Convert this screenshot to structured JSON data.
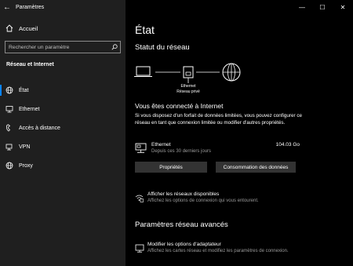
{
  "window": {
    "title": "Paramètres",
    "controls": [
      "—",
      "☐",
      "✕"
    ]
  },
  "sidebar": {
    "home_label": "Accueil",
    "search_placeholder": "Rechercher un paramètre",
    "section_title": "Réseau et Internet",
    "items": [
      {
        "label": "État",
        "icon": "globe-status-icon",
        "active": true
      },
      {
        "label": "Ethernet",
        "icon": "ethernet-icon",
        "active": false
      },
      {
        "label": "Accès à distance",
        "icon": "dialup-icon",
        "active": false
      },
      {
        "label": "VPN",
        "icon": "vpn-icon",
        "active": false
      },
      {
        "label": "Proxy",
        "icon": "globe-icon",
        "active": false
      }
    ]
  },
  "main": {
    "page_title": "État",
    "network_status_heading": "Statut du réseau",
    "diagram": {
      "adapter_name": "Ethernet",
      "network_type": "Réseau privé"
    },
    "connected_heading": "Vous êtes connecté à Internet",
    "description": "Si vous disposez d'un forfait de données limitées, vous pouvez configurer ce réseau en tant que connexion limitée ou modifier d'autres propriétés.",
    "connection": {
      "name": "Ethernet",
      "subtitle": "Depuis ces 30 derniers jours",
      "usage": "104.03 Go"
    },
    "buttons": {
      "properties": "Propriétés",
      "data_usage": "Consommation des données"
    },
    "show_networks": {
      "title": "Afficher les réseaux disponibles",
      "subtitle": "Affichez les options de connexion qui vous entourent."
    },
    "advanced_heading": "Paramètres réseau avancés",
    "adapter_options": {
      "title": "Modifier les options d'adaptateur",
      "subtitle": "Affichez les cartes réseau et modifiez les paramètres de connexion."
    }
  },
  "colors": {
    "sidebar_bg": "#1f1f1f",
    "main_bg": "#000000",
    "accent": "#0a84ff",
    "button_bg": "#333333",
    "secondary_text": "#9a9a9a"
  }
}
